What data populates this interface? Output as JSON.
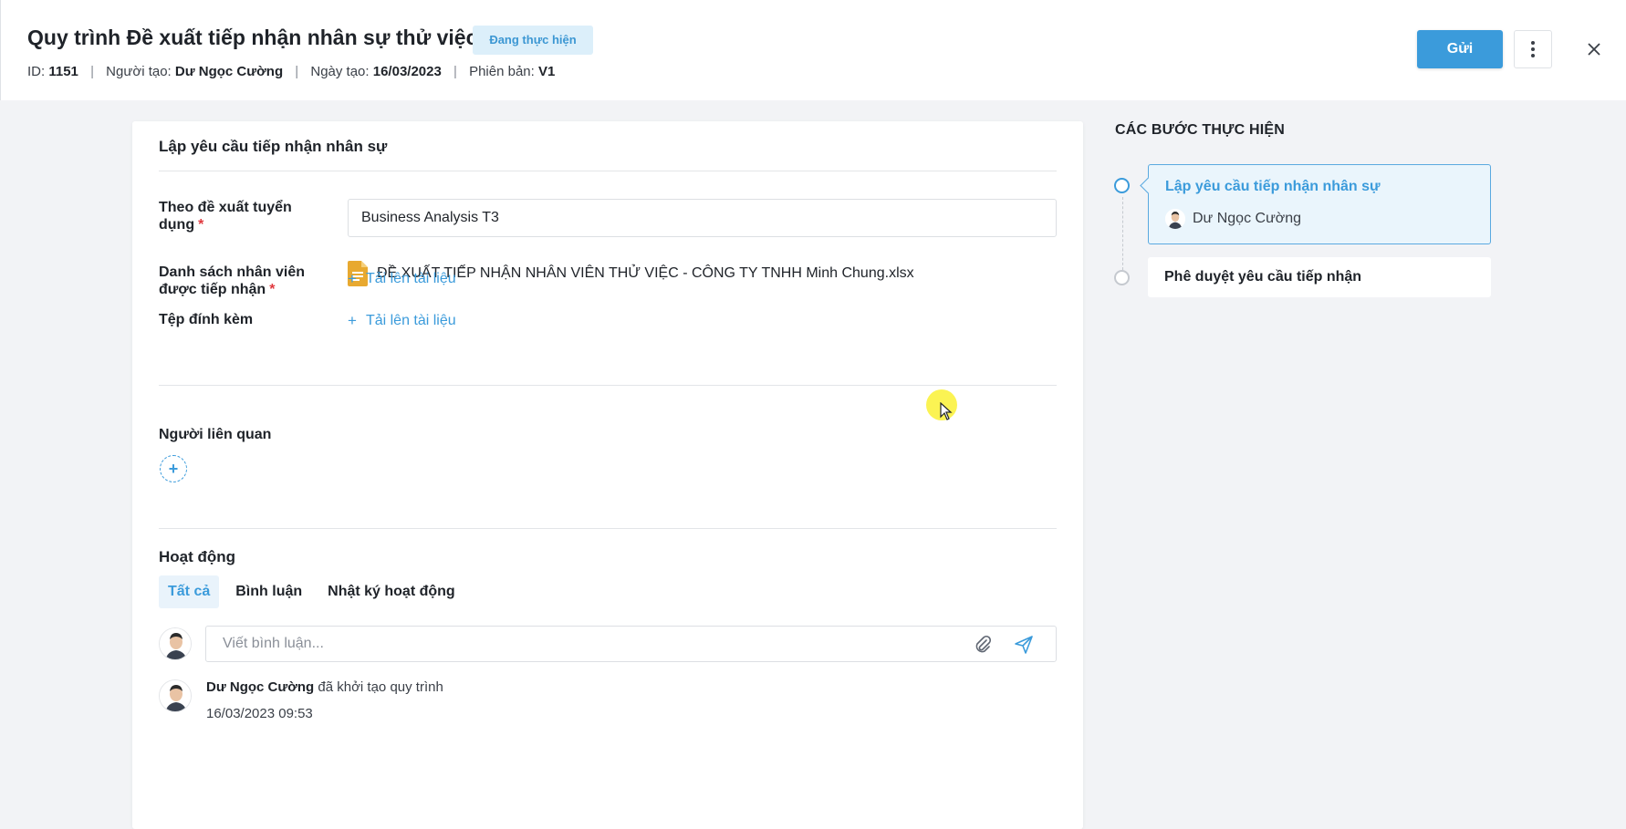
{
  "header": {
    "title": "Quy trình Đề xuất tiếp nhận nhân sự thử việc",
    "status": "Đang thực hiện",
    "meta": {
      "id_label": "ID:",
      "id_value": "1151",
      "creator_label": "Người tạo:",
      "creator_value": "Dư Ngọc Cường",
      "date_label": "Ngày tạo:",
      "date_value": "16/03/2023",
      "version_label": "Phiên bản:",
      "version_value": "V1",
      "separator": "|"
    },
    "send_label": "Gửi",
    "more_icon": "more-vertical-icon",
    "close_icon": "close-icon"
  },
  "form": {
    "section_title": "Lập yêu cầu tiếp nhận nhân sự",
    "recruitment_label": "Theo đề xuất tuyển dụng",
    "recruitment_value": "Business Analysis T3",
    "employee_list_label": "Danh sách nhân viên được tiếp nhận",
    "employee_file_name": "ĐỀ XUẤT TIẾP NHẬN NHÂN VIÊN THỬ VIỆC - CÔNG TY TNHH Minh Chung.xlsx",
    "upload_label": "Tải lên tài liệu",
    "attachment_label": "Tệp đính kèm",
    "attachment_upload_label": "Tải lên tài liệu",
    "related_people_label": "Người liên quan",
    "required_mark": "*",
    "plus_symbol": "+"
  },
  "activity": {
    "title": "Hoạt động",
    "tabs": [
      {
        "label": "Tất cả",
        "active": true
      },
      {
        "label": "Bình luận",
        "active": false
      },
      {
        "label": "Nhật ký hoạt động",
        "active": false
      }
    ],
    "comment_placeholder": "Viết bình luận...",
    "log": {
      "actor": "Dư Ngọc Cường",
      "action": "đã khởi tạo quy trình",
      "time": "16/03/2023 09:53"
    }
  },
  "steps": {
    "title": "CÁC BƯỚC THỰC HIỆN",
    "items": [
      {
        "label": "Lập yêu cầu tiếp nhận nhân sự",
        "assignee": "Dư Ngọc Cường",
        "active": true
      },
      {
        "label": "Phê duyệt yêu cầu tiếp nhận",
        "active": false
      }
    ]
  },
  "colors": {
    "accent": "#3b9bdb",
    "status_bg": "#dceffa",
    "required": "#e0393e",
    "file_icon": "#e8a930"
  }
}
